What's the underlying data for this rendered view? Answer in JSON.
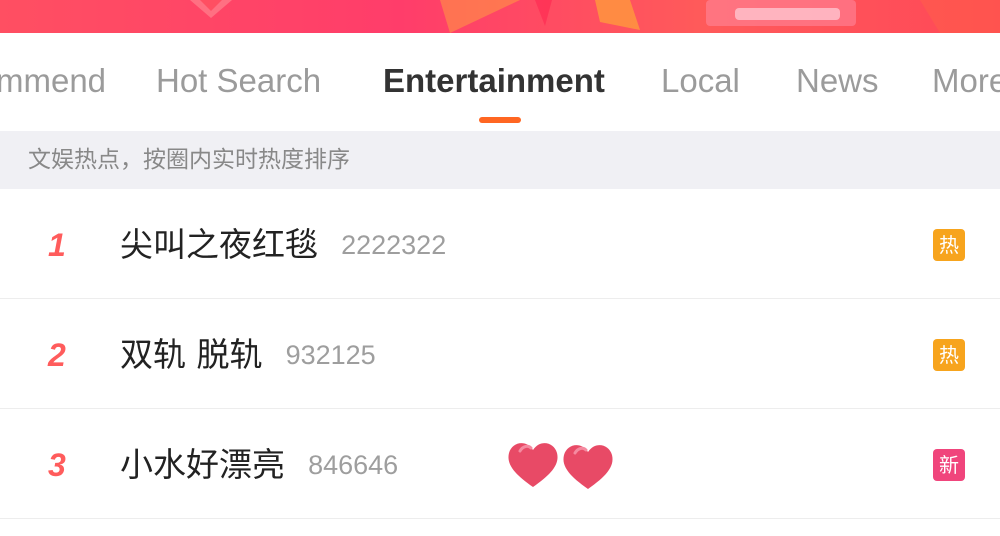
{
  "tabs": [
    {
      "label": "mmend",
      "active": false
    },
    {
      "label": "Hot Search",
      "active": false
    },
    {
      "label": "Entertainment",
      "active": true
    },
    {
      "label": "Local",
      "active": false
    },
    {
      "label": "News",
      "active": false
    },
    {
      "label": "More",
      "active": false
    }
  ],
  "subtitle": "文娱热点，按圈内实时热度排序",
  "rows": [
    {
      "rank": "1",
      "title": "尖叫之夜红毯",
      "count": "2222322",
      "badge": "热",
      "badge_color": "#f7a41d",
      "badge_icon": "hot-badge-icon"
    },
    {
      "rank": "2",
      "title": "双轨 脱轨",
      "count": "932125",
      "badge": "热",
      "badge_color": "#f7a41d",
      "badge_icon": "hot-badge-icon"
    },
    {
      "rank": "3",
      "title": "小水好漂亮",
      "count": "846646",
      "badge": "新",
      "badge_color": "#f0457c",
      "badge_icon": "new-badge-icon"
    }
  ],
  "colors": {
    "accent": "#ff6622",
    "rank": "#ff5c5c",
    "banner": "#ff4f62",
    "hearts": "#e84a66"
  },
  "decorations": {
    "row3_hearts": "hearts-sticker"
  }
}
